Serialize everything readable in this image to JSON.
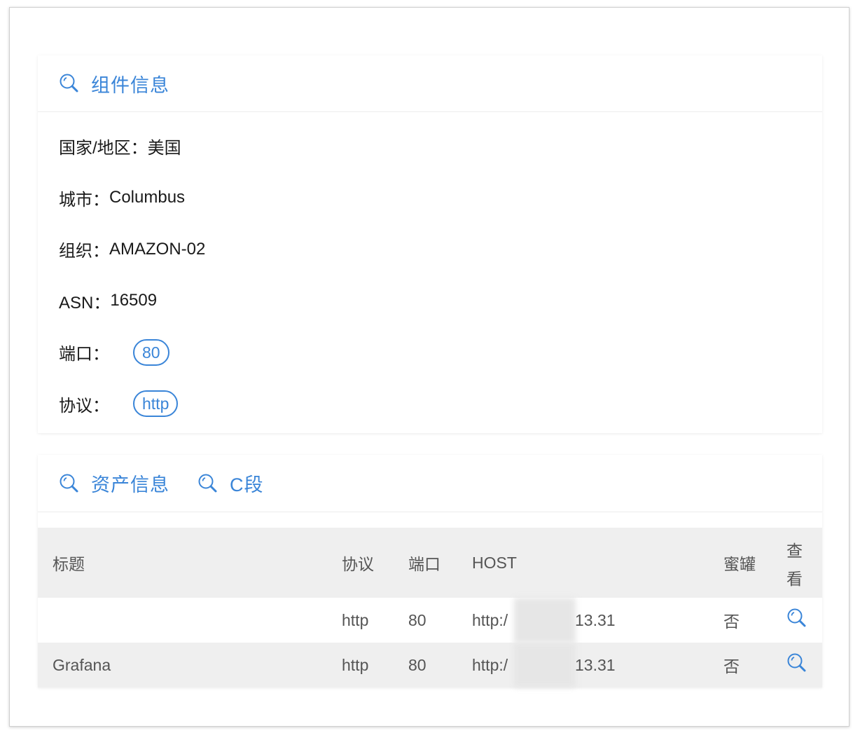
{
  "component_section": {
    "title": "组件信息",
    "icon": "search-icon",
    "rows": [
      {
        "label": "国家/地区：",
        "value": "美国"
      },
      {
        "label": "城市：",
        "value": "Columbus"
      },
      {
        "label": "组织：",
        "value": "AMAZON-02"
      },
      {
        "label": "ASN：",
        "value": "16509"
      }
    ],
    "port_label": "端口：",
    "port_tag": "80",
    "protocol_label": "协议：",
    "protocol_tag": "http"
  },
  "asset_section": {
    "tab_assets": "资产信息",
    "tab_c_segment": "C段",
    "table": {
      "headers": {
        "title": "标题",
        "protocol": "协议",
        "port": "端口",
        "host": "HOST",
        "honeypot": "蜜罐",
        "view_1": "查",
        "view_2": "看"
      },
      "rows": [
        {
          "title": "",
          "protocol": "http",
          "port": "80",
          "host_prefix": "http:/",
          "host_suffix": "13.31",
          "honeypot": "否"
        },
        {
          "title": "Grafana",
          "protocol": "http",
          "port": "80",
          "host_prefix": "http:/",
          "host_suffix": "13.31",
          "honeypot": "否"
        }
      ]
    }
  },
  "colors": {
    "accent": "#3a85d8",
    "row_alt_bg": "#efefef",
    "text": "#1a1a1a",
    "muted_text": "#555555"
  }
}
